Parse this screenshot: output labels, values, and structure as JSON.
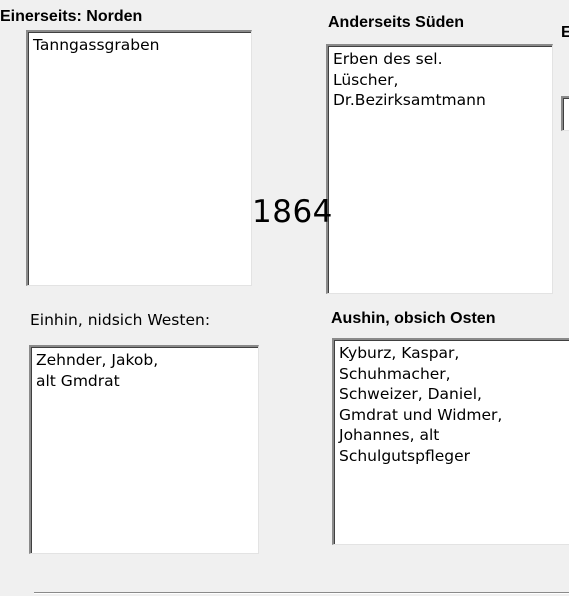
{
  "labels": {
    "north": "Einerseits: Norden",
    "south": "Anderseits Süden",
    "partial_right": "E",
    "west": "Einhin, nidsich Westen:",
    "east": "Aushin,  obsich Osten"
  },
  "fields": {
    "north_value": "Tanngassgraben",
    "south_value": "Erben des sel.\nLüscher,\nDr.Bezirksamtmann",
    "west_value": "Zehnder, Jakob,\nalt Gmdrat",
    "east_value": "Kyburz, Kaspar,\nSchuhmacher,\nSchweizer, Daniel,\nGmdrat und Widmer,\nJohannes, alt\nSchulgutspfleger",
    "right_partial_value": ""
  },
  "overlay": {
    "year": "1864"
  }
}
